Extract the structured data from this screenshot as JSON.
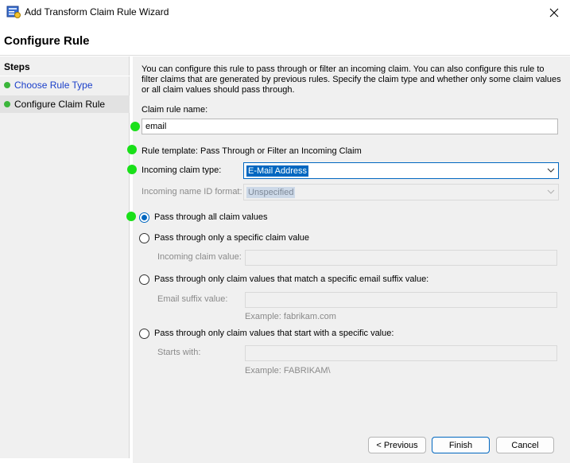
{
  "window": {
    "title": "Add Transform Claim Rule Wizard",
    "app_icon": "wizard-app-icon",
    "close_icon": "close-icon"
  },
  "header": {
    "title": "Configure Rule"
  },
  "steps": {
    "heading": "Steps",
    "items": [
      {
        "label": "Choose Rule Type",
        "status": "complete",
        "color": "#1a3fc9"
      },
      {
        "label": "Configure Claim Rule",
        "status": "current",
        "color": "#000000"
      }
    ],
    "dot_color": "#3bb63b"
  },
  "main": {
    "description": "You can configure this rule to pass through or filter an incoming claim. You can also configure this rule to filter claims that are generated by previous rules. Specify the claim type and whether only some claim values or all claim values should pass through.",
    "claim_rule_name": {
      "label": "Claim rule name:",
      "value": "email"
    },
    "rule_template": "Rule template: Pass Through or Filter an Incoming Claim",
    "incoming_claim_type": {
      "label": "Incoming claim type:",
      "value": "E-Mail Address"
    },
    "incoming_name_id_format": {
      "label": "Incoming name ID format:",
      "value": "Unspecified",
      "enabled": false
    },
    "options": [
      {
        "label": "Pass through all claim values",
        "selected": true
      },
      {
        "label": "Pass through only a specific claim value",
        "selected": false,
        "field_label": "Incoming claim value:"
      },
      {
        "label": "Pass through only claim values that match a specific email suffix value:",
        "selected": false,
        "field_label": "Email suffix value:",
        "example": "Example: fabrikam.com"
      },
      {
        "label": "Pass through only claim values that start with a specific value:",
        "selected": false,
        "field_label": "Starts with:",
        "example": "Example: FABRIKAM\\"
      }
    ]
  },
  "buttons": {
    "previous": "< Previous",
    "finish": "Finish",
    "cancel": "Cancel"
  },
  "colors": {
    "accent": "#0067c0",
    "marker_green": "#19e019"
  }
}
